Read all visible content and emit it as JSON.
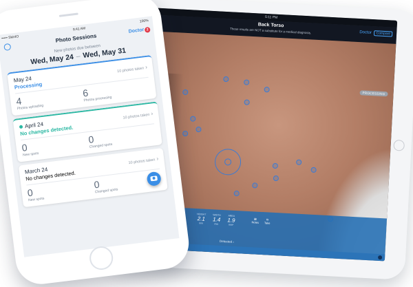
{
  "tablet": {
    "status_time": "5:11 PM",
    "title": "Back Torso",
    "disclaimer": "These results are NOT a substitute for a medical diagnosis.",
    "doctor_label": "Doctor",
    "compare_label": "Compare",
    "processing_badge": "PROCESSING",
    "stats": [
      {
        "value": "2.1",
        "unit": "mm",
        "label": "HEIGHT"
      },
      {
        "value": "1.4",
        "unit": "mm",
        "label": "WIDTH"
      },
      {
        "value": "1.9",
        "unit": "mm²",
        "label": "AREA"
      }
    ],
    "tools": [
      {
        "icon": "notes-icon",
        "label": "Notes"
      },
      {
        "icon": "photos-icon",
        "label": "Take"
      }
    ],
    "detected_label": "Detected",
    "accent": "#3a7bd5"
  },
  "phone": {
    "status_carrier": "••••• SkinIO",
    "status_time": "9:41 AM",
    "status_battery": "100%",
    "nav_title": "Photo Sessions",
    "doctor_label": "Doctor",
    "doctor_badge": "2",
    "due_label": "New photos due between",
    "date_start": "Wed, May 24",
    "date_end": "Wed, May 31",
    "sessions": [
      {
        "date": "May 24",
        "status": "Processing",
        "status_color": "#3a8ee6",
        "taken": "10 photos taken",
        "left_value": "4",
        "left_label": "Photos uploading",
        "right_value": "6",
        "right_label": "Photos processing"
      },
      {
        "date": "April 24",
        "status": "No changes detected.",
        "status_color": "#2bb8a3",
        "taken": "10 photos taken",
        "left_value": "0",
        "left_label": "New spots",
        "right_value": "0",
        "right_label": "Changed spots"
      },
      {
        "date": "March 24",
        "status": "No changes detected.",
        "status_color": "#1e2b3c",
        "taken": "10 photos taken",
        "left_value": "0",
        "left_label": "New spots",
        "right_value": "0",
        "right_label": "Changed spots"
      }
    ],
    "accent": "#3a8ee6"
  }
}
